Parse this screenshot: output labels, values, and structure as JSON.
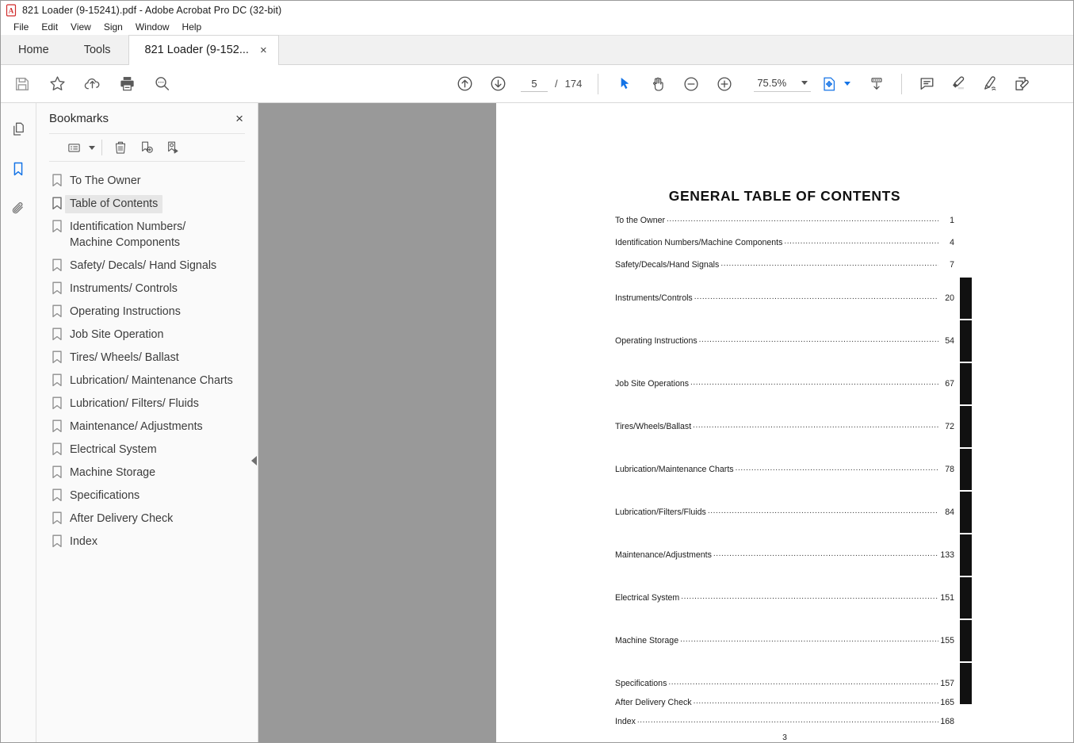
{
  "window": {
    "title": "821 Loader (9-15241).pdf - Adobe Acrobat Pro DC (32-bit)",
    "app_icon": "acrobat-icon"
  },
  "menubar": {
    "items": [
      {
        "label": "File"
      },
      {
        "label": "Edit"
      },
      {
        "label": "View"
      },
      {
        "label": "Sign"
      },
      {
        "label": "Window"
      },
      {
        "label": "Help"
      }
    ]
  },
  "tabs": {
    "home": "Home",
    "tools": "Tools",
    "document": "821 Loader (9-152...",
    "close_glyph": "×"
  },
  "toolbar": {
    "left_buttons": [
      {
        "name": "save-icon",
        "label": "Save"
      },
      {
        "name": "star-icon",
        "label": "Add to favorites"
      },
      {
        "name": "cloud-upload-icon",
        "label": "Upload to cloud"
      },
      {
        "name": "print-icon",
        "label": "Print file"
      },
      {
        "name": "search-icon",
        "label": "Find text"
      }
    ],
    "prev_page": "Previous page",
    "next_page": "Next page",
    "page_value": "5",
    "page_separator": "/",
    "page_total": "174",
    "select_tool": "Select tool",
    "hand_tool": "Hand tool",
    "zoom_out": "Zoom out",
    "zoom_in": "Zoom in",
    "zoom_value": "75.5%",
    "right_buttons": [
      {
        "name": "fit-page-icon",
        "label": "Fit page"
      },
      {
        "name": "scroll-mode-icon",
        "label": "Page display"
      },
      {
        "name": "comment-icon",
        "label": "Add comment"
      },
      {
        "name": "highlight-icon",
        "label": "Highlight text"
      },
      {
        "name": "draw-icon",
        "label": "Draw free form"
      },
      {
        "name": "sign-icon",
        "label": "Fill & Sign"
      }
    ]
  },
  "rail": {
    "items": [
      {
        "name": "page-thumbnails-icon",
        "label": "Page Thumbnails",
        "active": false
      },
      {
        "name": "bookmarks-icon",
        "label": "Bookmarks",
        "active": true
      },
      {
        "name": "attachments-icon",
        "label": "Attachments",
        "active": false
      }
    ]
  },
  "panel": {
    "title": "Bookmarks",
    "close_glyph": "×",
    "tools": [
      {
        "name": "bookmark-options-icon",
        "label": "Options"
      },
      {
        "name": "delete-bookmark-icon",
        "label": "Delete Bookmark"
      },
      {
        "name": "new-bookmark-icon",
        "label": "New Bookmark"
      },
      {
        "name": "edit-bookmark-icon",
        "label": "Edit Bookmark"
      }
    ],
    "bookmarks": [
      {
        "label": "To The Owner",
        "selected": false
      },
      {
        "label": "Table of Contents",
        "selected": true
      },
      {
        "label": "Identification Numbers/\nMachine Components",
        "selected": false
      },
      {
        "label": "Safety/ Decals/ Hand Signals",
        "selected": false
      },
      {
        "label": "Instruments/ Controls",
        "selected": false
      },
      {
        "label": "Operating Instructions",
        "selected": false
      },
      {
        "label": "Job Site Operation",
        "selected": false
      },
      {
        "label": "Tires/ Wheels/ Ballast",
        "selected": false
      },
      {
        "label": "Lubrication/ Maintenance Charts",
        "selected": false
      },
      {
        "label": "Lubrication/ Filters/ Fluids",
        "selected": false
      },
      {
        "label": "Maintenance/ Adjustments",
        "selected": false
      },
      {
        "label": "Electrical System",
        "selected": false
      },
      {
        "label": "Machine Storage",
        "selected": false
      },
      {
        "label": "Specifications",
        "selected": false
      },
      {
        "label": "After Delivery Check",
        "selected": false
      },
      {
        "label": "Index",
        "selected": false
      }
    ]
  },
  "document": {
    "heading": "GENERAL TABLE OF CONTENTS",
    "folio": "3",
    "entries": [
      {
        "label": "To the Owner",
        "page": "1",
        "gap": 0,
        "tab": false
      },
      {
        "label": "Identification Numbers/Machine Components",
        "page": "4",
        "gap": 16,
        "tab": false
      },
      {
        "label": "Safety/Decals/Hand Signals",
        "page": "7",
        "gap": 16,
        "tab": false
      },
      {
        "label": "Instruments/Controls",
        "page": "20",
        "gap": 30,
        "tab": true
      },
      {
        "label": "Operating Instructions",
        "page": "54",
        "gap": 42,
        "tab": true
      },
      {
        "label": "Job Site Operations",
        "page": "67",
        "gap": 42,
        "tab": true
      },
      {
        "label": "Tires/Wheels/Ballast",
        "page": "72",
        "gap": 42,
        "tab": true
      },
      {
        "label": "Lubrication/Maintenance Charts",
        "page": "78",
        "gap": 42,
        "tab": true
      },
      {
        "label": "Lubrication/Filters/Fluids",
        "page": "84",
        "gap": 42,
        "tab": true
      },
      {
        "label": "Maintenance/Adjustments",
        "page": "133",
        "gap": 42,
        "tab": true
      },
      {
        "label": "Electrical System",
        "page": "151",
        "gap": 42,
        "tab": true
      },
      {
        "label": "Machine Storage",
        "page": "155",
        "gap": 42,
        "tab": true
      },
      {
        "label": "Specifications",
        "page": "157",
        "gap": 42,
        "tab": true
      },
      {
        "label": "After Delivery Check",
        "page": "165",
        "gap": 12,
        "tab": false
      },
      {
        "label": "Index",
        "page": "168",
        "gap": 12,
        "tab": false
      }
    ]
  },
  "colors": {
    "accent": "#1473e6",
    "gutter": "#999999",
    "panel_bg": "#fafafa",
    "selection": "#e6e6e6"
  }
}
